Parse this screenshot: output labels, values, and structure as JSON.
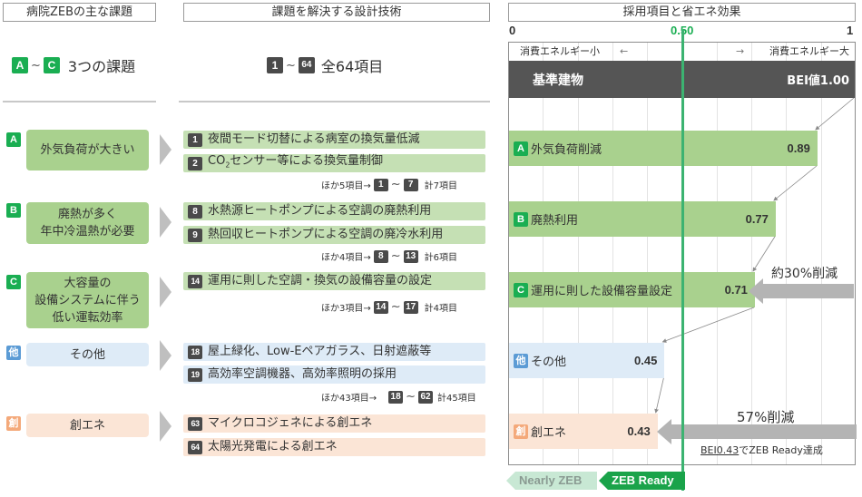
{
  "headers": {
    "issues": "病院ZEBの主な課題",
    "techniques": "課題を解決する設計技術",
    "effects": "採用項目と省エネ効果"
  },
  "summary": {
    "issues": {
      "badge_from": "A",
      "tilde": "~",
      "badge_to": "C",
      "text": "3つの課題"
    },
    "techniques": {
      "badge_from": "1",
      "tilde": "~",
      "badge_to": "64",
      "text": "全64項目"
    }
  },
  "issues": [
    {
      "badge": "A",
      "label": "外気負荷が大きい",
      "color": "#a9d18e"
    },
    {
      "badge": "B",
      "label": "廃熱が多く\n年中冷温熱が必要",
      "color": "#a9d18e"
    },
    {
      "badge": "C",
      "label": "大容量の\n設備システムに伴う\n低い運転効率",
      "color": "#a9d18e"
    },
    {
      "badge": "他",
      "label": "その他",
      "color": "#deebf7"
    },
    {
      "badge": "創",
      "label": "創エネ",
      "color": "#fbe5d6"
    }
  ],
  "techniques": [
    {
      "num": "1",
      "label": "夜間モード切替による病室の換気量低減"
    },
    {
      "num": "2",
      "label_pre": "CO",
      "label_sub": "2",
      "label_post": "センサー等による換気量制御"
    },
    {
      "num": "8",
      "label": "水熱源ヒートポンプによる空調の廃熱利用"
    },
    {
      "num": "9",
      "label": "熱回収ヒートポンプによる空調の廃冷水利用"
    },
    {
      "num": "14",
      "label": "運用に則した空調・換気の設備容量の設定"
    },
    {
      "num": "18",
      "label": "屋上緑化、Low-Eペアガラス、日射遮蔽等"
    },
    {
      "num": "19",
      "label": "高効率空調機器、高効率照明の採用"
    },
    {
      "num": "63",
      "label": "マイクロコジェネによる創エネ"
    },
    {
      "num": "64",
      "label": "太陽光発電による創エネ"
    }
  ],
  "more_items": [
    {
      "text": "ほか5項目→",
      "from": "1",
      "to": "7",
      "total": "計7項目"
    },
    {
      "text": "ほか4項目→",
      "from": "8",
      "to": "13",
      "total": "計6項目"
    },
    {
      "text": "ほか3項目→",
      "from": "14",
      "to": "17",
      "total": "計4項目"
    },
    {
      "text": "ほか43項目→",
      "from": "18",
      "to": "62",
      "total": "計45項目"
    }
  ],
  "chart_data": {
    "type": "bar",
    "orientation": "horizontal",
    "title": "採用項目と省エネ効果",
    "xlim": [
      0,
      1
    ],
    "x_ticks": [
      "0",
      "0.50",
      "1"
    ],
    "grid": true,
    "scale_left_label": "消費エネルギー小",
    "scale_left_arrow": "←",
    "scale_right_arrow": "→",
    "scale_right_label": "消費エネルギー大",
    "reference_line": {
      "value": 0.5,
      "label": "0.50",
      "color": "#3cb371"
    },
    "baseline": {
      "label": "基準建物",
      "value_label": "BEI値1.00",
      "value": 1.0,
      "color": "#555555"
    },
    "categories": [
      "外気負荷削減",
      "廃熱利用",
      "運用に則した設備容量設定",
      "その他",
      "創エネ"
    ],
    "badges": [
      "A",
      "B",
      "C",
      "他",
      "創"
    ],
    "values": [
      0.89,
      0.77,
      0.71,
      0.45,
      0.43
    ],
    "value_labels": [
      "0.89",
      "0.77",
      "0.71",
      "0.45",
      "0.43"
    ],
    "colors": [
      "#a9d18e",
      "#a9d18e",
      "#a9d18e",
      "#deebf7",
      "#fbe5d6"
    ],
    "annotations": [
      {
        "text": "約30%削減",
        "target": "運用に則した設備容量設定"
      },
      {
        "text": "57%削減",
        "target": "創エネ"
      },
      {
        "text_underlined": "BEI0.43",
        "text": "でZEB Ready達成"
      }
    ],
    "zones": [
      {
        "label": "Nearly ZEB",
        "color": "#c8e8d4"
      },
      {
        "label": "ZEB Ready",
        "color": "#1aa34a"
      }
    ]
  }
}
